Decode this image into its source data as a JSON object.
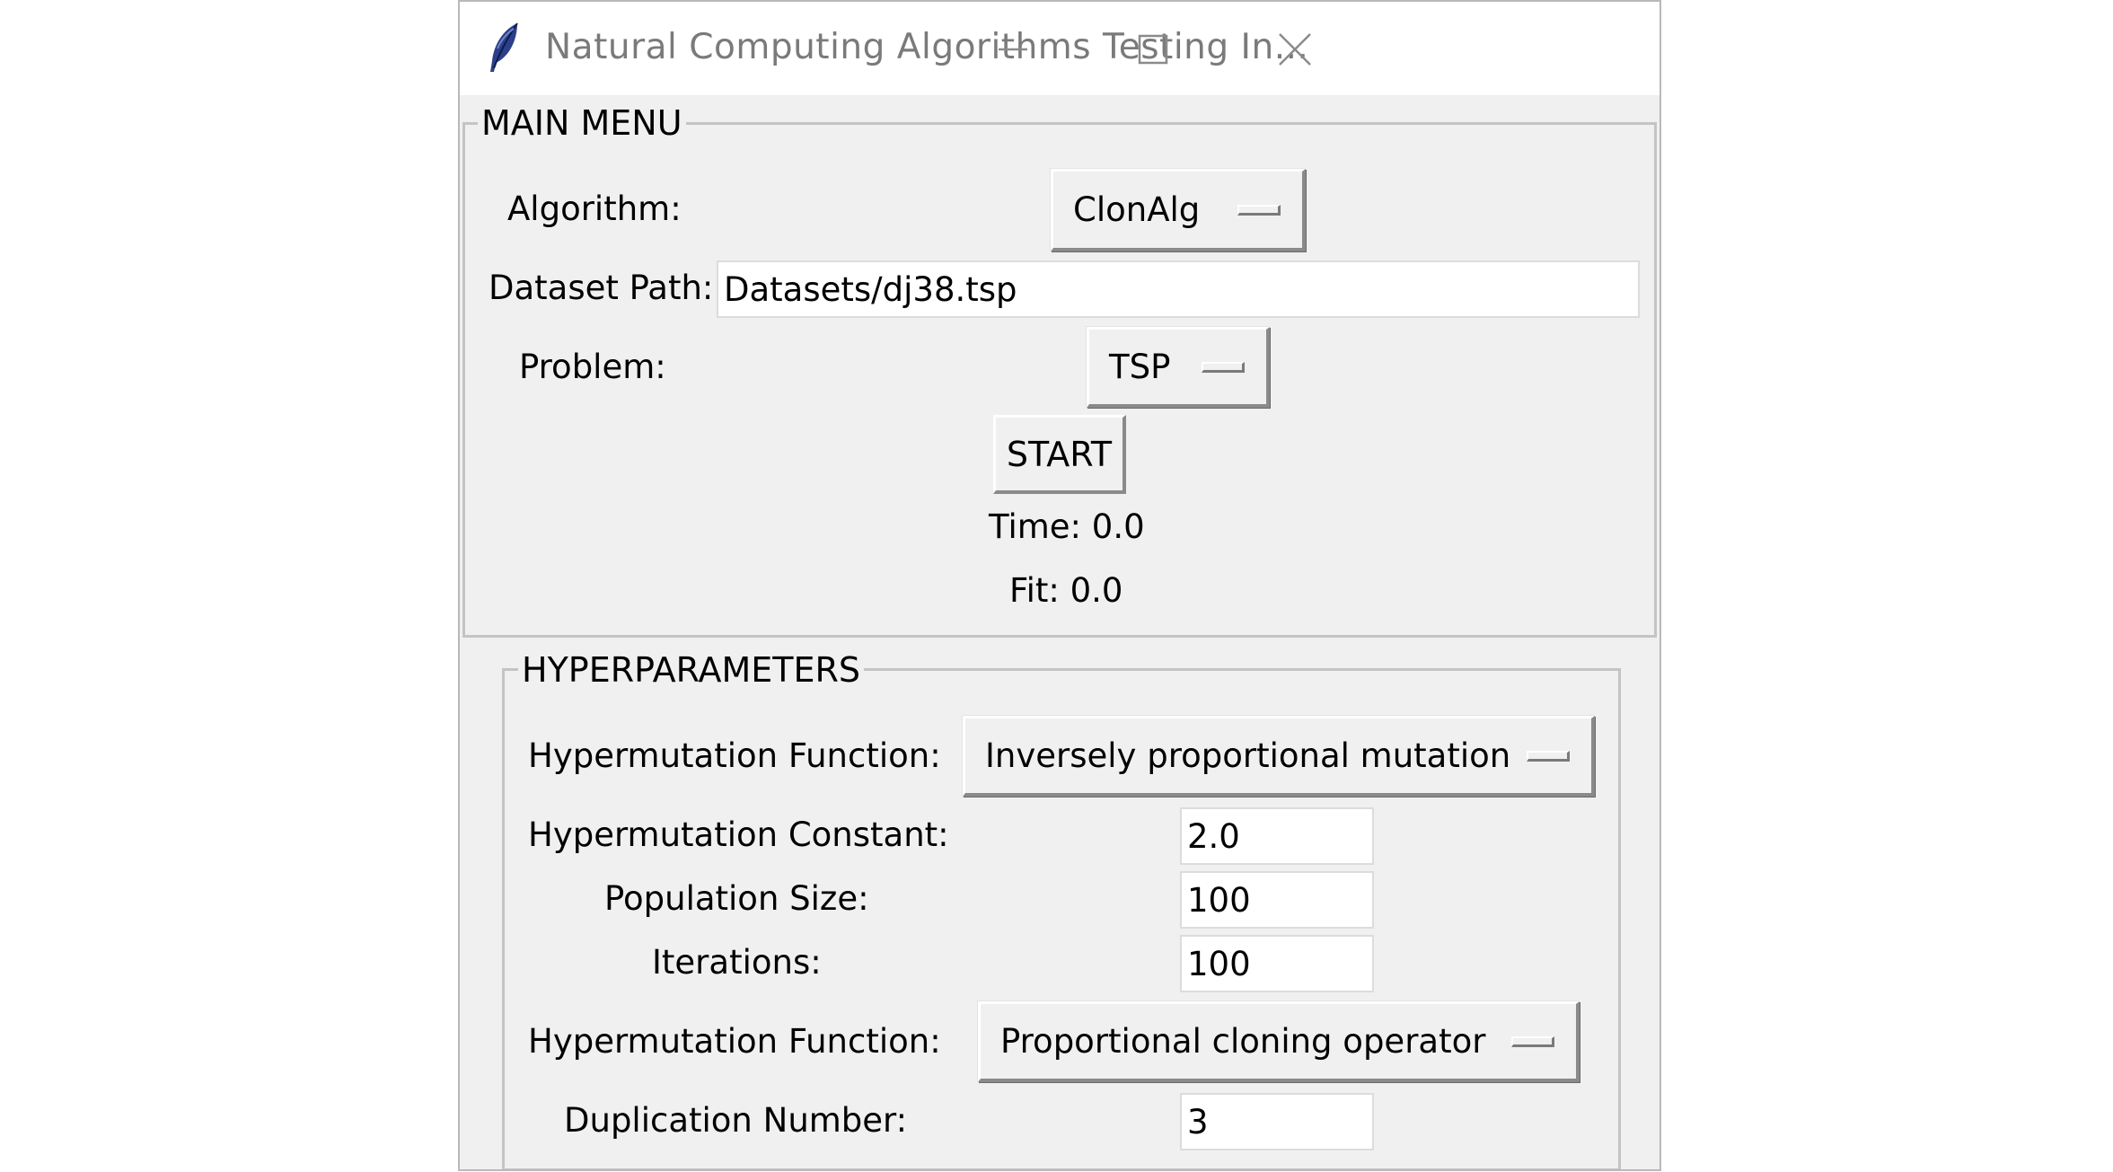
{
  "window": {
    "title": "Natural Computing Algorithms Testing In...",
    "icon": "feather-icon",
    "controls": [
      "minimize-icon",
      "maximize-icon",
      "close-icon"
    ]
  },
  "main_menu": {
    "frame_label": "MAIN MENU",
    "algorithm_label": "Algorithm:",
    "algorithm_value": "ClonAlg",
    "dataset_label": "Dataset Path:",
    "dataset_value": "Datasets/dj38.tsp",
    "problem_label": "Problem:",
    "problem_value": "TSP",
    "start_label": "START",
    "time_text": "Time: 0.0",
    "fit_text": "Fit: 0.0"
  },
  "hyperparameters": {
    "frame_label": "HYPERPARAMETERS",
    "hypermutation_function_label": "Hypermutation Function:",
    "hypermutation_function_value": "Inversely proportional mutation",
    "hypermutation_constant_label": "Hypermutation Constant:",
    "hypermutation_constant_value": "2.0",
    "population_size_label": "Population Size:",
    "population_size_value": "100",
    "iterations_label": "Iterations:",
    "iterations_value": "100",
    "cloning_function_label": "Hypermutation Function:",
    "cloning_function_value": "Proportional cloning operator",
    "duplication_number_label": "Duplication Number:",
    "duplication_number_value": "3"
  }
}
